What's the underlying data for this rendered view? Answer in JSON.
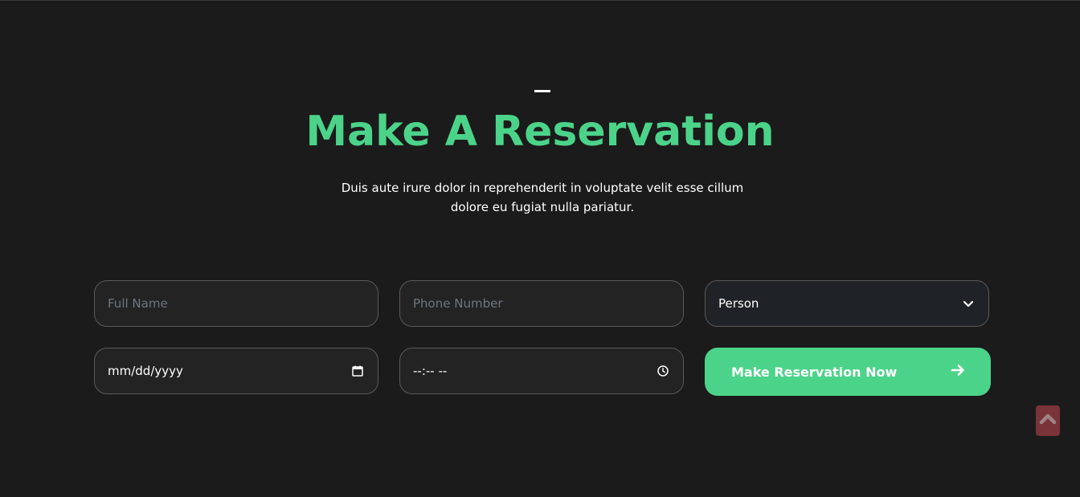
{
  "section": {
    "title": "Make A Reservation",
    "subtitle_line1": "Duis aute irure dolor in reprehenderit in voluptate velit esse cillum",
    "subtitle_line2": "dolore eu fugiat nulla pariatur."
  },
  "form": {
    "full_name_placeholder": "Full Name",
    "phone_placeholder": "Phone Number",
    "person_select_value": "Person",
    "date_value": "mm/dd/yyyy",
    "time_value": "--:-- --",
    "submit_label": "Make Reservation Now"
  },
  "icons": {
    "select_chevron": "chevron-down-icon",
    "date": "calendar-icon",
    "time": "clock-icon",
    "submit_arrow": "arrow-right-icon",
    "scroll_top": "chevron-up-icon"
  },
  "colors": {
    "accent": "#4cd38a",
    "background": "#1b1b1b",
    "scroll_top_bg": "#7a3338"
  }
}
